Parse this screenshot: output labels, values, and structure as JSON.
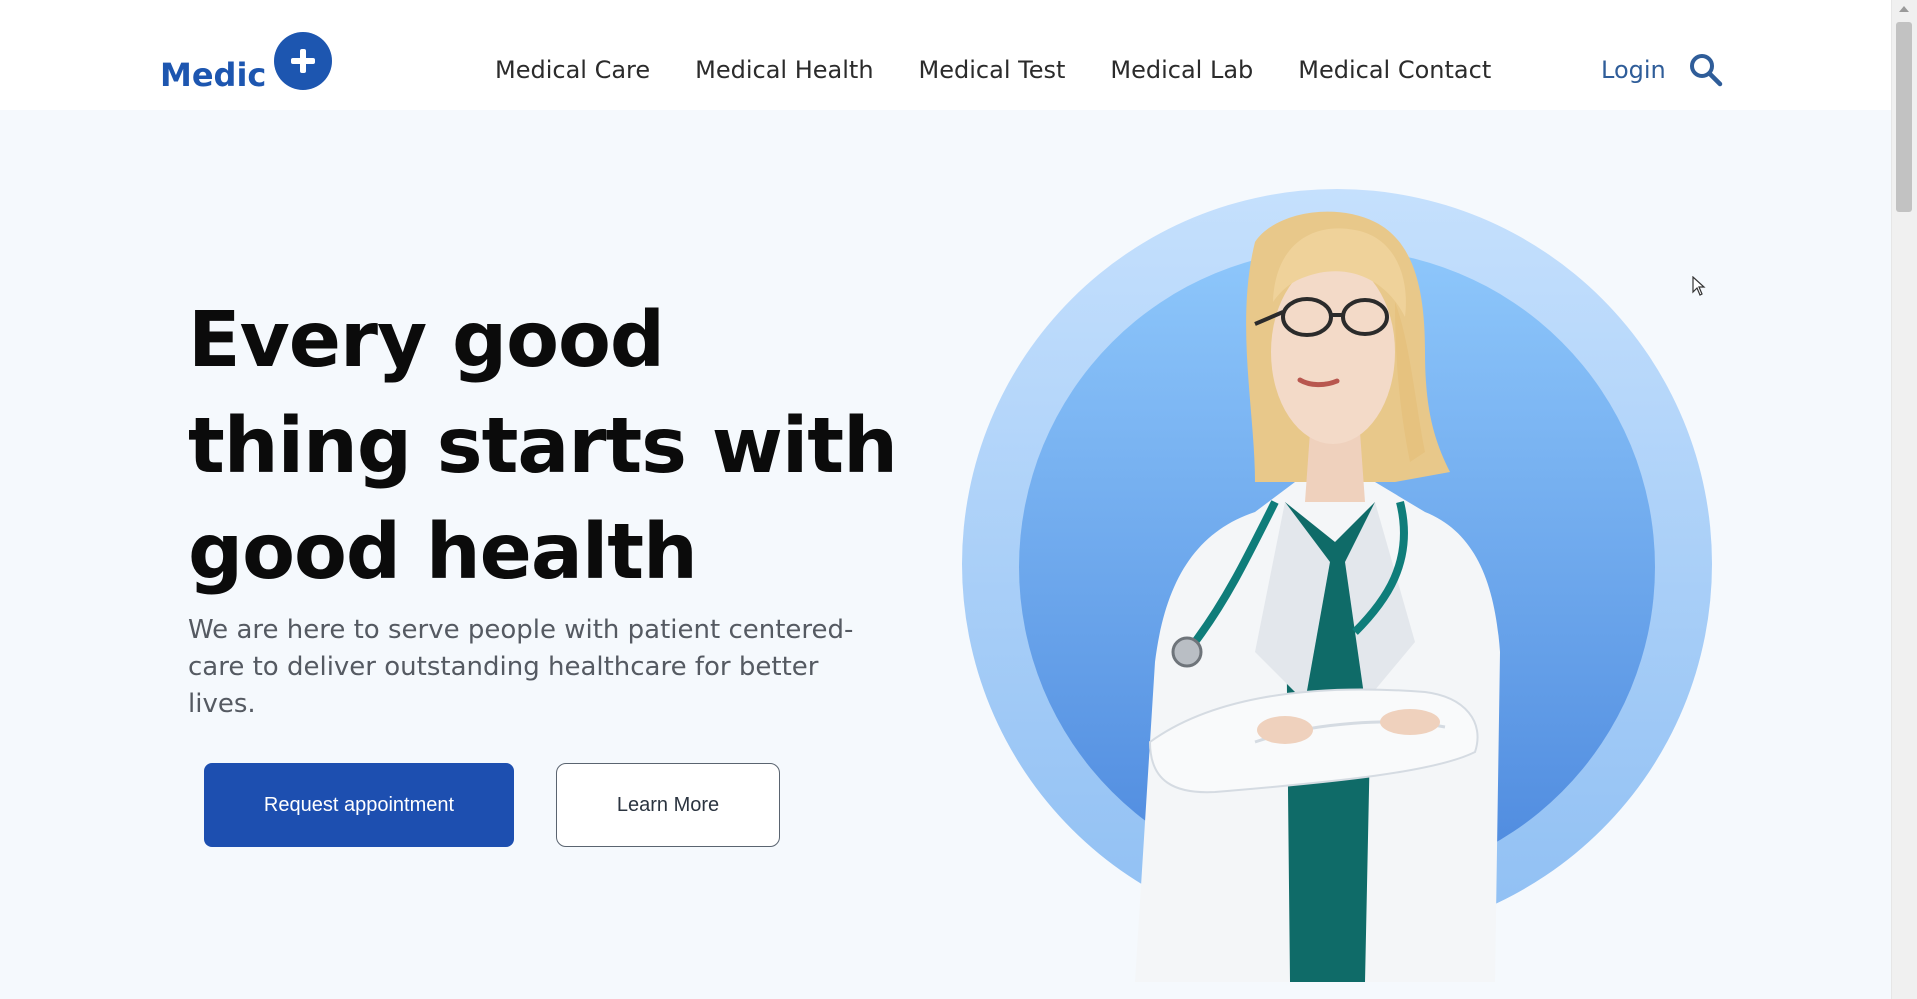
{
  "brand": {
    "name": "Medic",
    "icon": "plus-circle-icon",
    "color": "#1d56b0"
  },
  "nav": {
    "items": [
      {
        "label": "Medical Care"
      },
      {
        "label": "Medical Health"
      },
      {
        "label": "Medical Test"
      },
      {
        "label": "Medical Lab"
      },
      {
        "label": "Medical Contact"
      }
    ],
    "login_label": "Login",
    "search_icon": "search-icon"
  },
  "hero": {
    "headline": "Every good thing starts with good health",
    "subtext": "We are here to serve people with patient centered-care to deliver outstanding healthcare for better lives.",
    "primary_button": "Request appointment",
    "secondary_button": "Learn More",
    "image": "doctor-portrait"
  },
  "colors": {
    "accent": "#1d4fb0",
    "background": "#f5f9fd",
    "circle_outer": "#b9d8fb",
    "circle_inner": "#78b6f7"
  }
}
